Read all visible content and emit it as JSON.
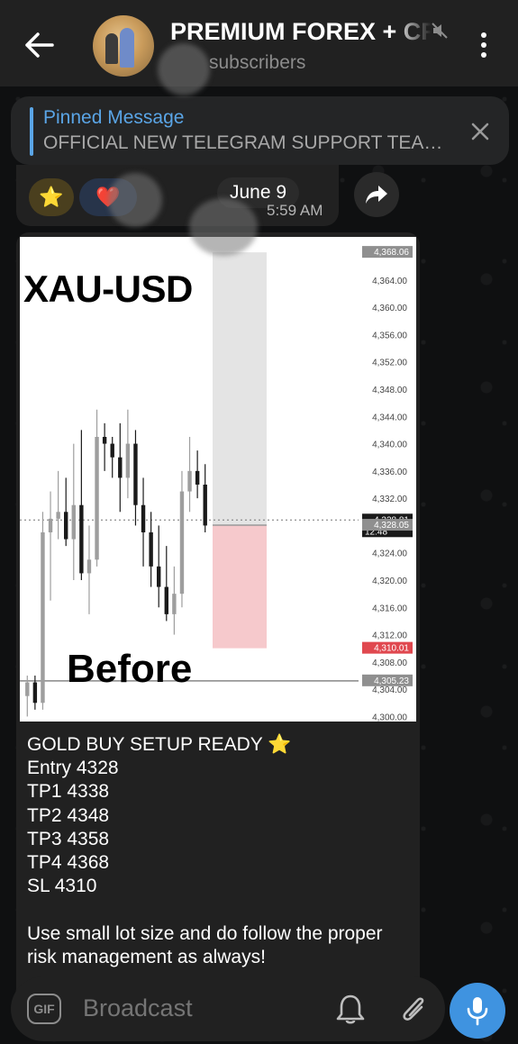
{
  "header": {
    "title": "PREMIUM FOREX + CRYPTO",
    "subtitle": "subscribers"
  },
  "pinned": {
    "label": "Pinned Message",
    "text": "OFFICIAL NEW TELEGRAM SUPPORT TEA…"
  },
  "previous_message": {
    "reactions": [
      "⭐",
      "❤️"
    ],
    "date_pill": "June 9",
    "time": "5:59 AM"
  },
  "post": {
    "lines": [
      "GOLD BUY SETUP READY ⭐",
      "Entry 4328",
      "TP1 4338",
      "TP2 4348",
      "TP3 4358",
      "TP4 4368",
      "SL 4310",
      "",
      "Use small lot size and do follow the proper",
      "risk management as always!"
    ]
  },
  "chart_data": {
    "type": "candlestick",
    "title": "XAU-USD",
    "annotation": "Before",
    "y_ticks": [
      "4,364.00",
      "4,360.00",
      "4,356.00",
      "4,352.00",
      "4,348.00",
      "4,344.00",
      "4,340.00",
      "4,336.00",
      "4,332.00",
      "4,324.00",
      "4,320.00",
      "4,316.00",
      "4,312.00",
      "4,308.00",
      "4,304.00",
      "4,300.00"
    ],
    "y_tick_values": [
      4364,
      4360,
      4356,
      4352,
      4348,
      4344,
      4340,
      4336,
      4332,
      4324,
      4320,
      4316,
      4312,
      4308,
      4304,
      4300
    ],
    "ylim": [
      4299,
      4369
    ],
    "price_labels": [
      {
        "text": "4,368.06",
        "value": 4368.06,
        "color": "#8f8f8f"
      },
      {
        "text": "4,328.81",
        "sub": "12:48",
        "value": 4328.81,
        "color": "#1a1a1a"
      },
      {
        "text": "4,328.05",
        "value": 4328.05,
        "color": "#8f8f8f"
      },
      {
        "text": "4,310.01",
        "value": 4310.01,
        "color": "#e0484f"
      },
      {
        "text": "4,305.23",
        "value": 4305.23,
        "color": "#8f8f8f"
      }
    ],
    "target_zone": [
      4328.05,
      4368.06
    ],
    "stop_zone": [
      4310.01,
      4328.05
    ],
    "candles": [
      {
        "o": 4303,
        "h": 4306,
        "l": 4300,
        "c": 4305
      },
      {
        "o": 4305,
        "h": 4306,
        "l": 4301,
        "c": 4302
      },
      {
        "o": 4302,
        "h": 4330,
        "l": 4301,
        "c": 4327
      },
      {
        "o": 4327,
        "h": 4333,
        "l": 4317,
        "c": 4329
      },
      {
        "o": 4329,
        "h": 4336,
        "l": 4326,
        "c": 4330
      },
      {
        "o": 4330,
        "h": 4335,
        "l": 4325,
        "c": 4326
      },
      {
        "o": 4326,
        "h": 4340,
        "l": 4320,
        "c": 4331
      },
      {
        "o": 4331,
        "h": 4342,
        "l": 4320,
        "c": 4321
      },
      {
        "o": 4321,
        "h": 4328,
        "l": 4315,
        "c": 4323
      },
      {
        "o": 4323,
        "h": 4345,
        "l": 4322,
        "c": 4341
      },
      {
        "o": 4341,
        "h": 4343,
        "l": 4336,
        "c": 4340
      },
      {
        "o": 4340,
        "h": 4341,
        "l": 4335,
        "c": 4338
      },
      {
        "o": 4338,
        "h": 4343,
        "l": 4330,
        "c": 4335
      },
      {
        "o": 4335,
        "h": 4345,
        "l": 4332,
        "c": 4340
      },
      {
        "o": 4340,
        "h": 4342,
        "l": 4328,
        "c": 4331
      },
      {
        "o": 4331,
        "h": 4335,
        "l": 4322,
        "c": 4327
      },
      {
        "o": 4327,
        "h": 4330,
        "l": 4319,
        "c": 4322
      },
      {
        "o": 4322,
        "h": 4328,
        "l": 4316,
        "c": 4319
      },
      {
        "o": 4319,
        "h": 4325,
        "l": 4314,
        "c": 4315
      },
      {
        "o": 4315,
        "h": 4322,
        "l": 4312,
        "c": 4318
      },
      {
        "o": 4318,
        "h": 4336,
        "l": 4316,
        "c": 4333
      },
      {
        "o": 4333,
        "h": 4341,
        "l": 4330,
        "c": 4336
      },
      {
        "o": 4336,
        "h": 4339,
        "l": 4332,
        "c": 4334
      },
      {
        "o": 4334,
        "h": 4337,
        "l": 4327,
        "c": 4328
      }
    ]
  },
  "composer": {
    "gif_label": "GIF",
    "placeholder": "Broadcast"
  },
  "colors": {
    "accent": "#3f93e0",
    "link": "#5aa5e6",
    "sl_zone": "#f6c9cc",
    "tp_zone": "#e4e4e4"
  }
}
